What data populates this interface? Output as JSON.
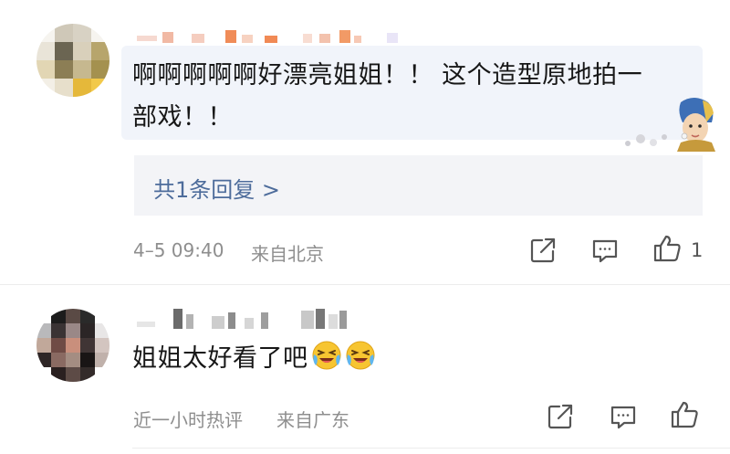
{
  "comments": [
    {
      "text_line1": "啊啊啊啊啊好漂亮姐姐！！ 这个造型原地拍一",
      "text_line2": "部戏！！",
      "replies_link": "共1条回复 >",
      "timestamp": "4–5 09:40",
      "location": "来自北京",
      "like_count": "1"
    },
    {
      "text": "姐姐太好看了吧",
      "emojis": [
        "laugh-cry-emoji",
        "laugh-cry-emoji"
      ],
      "timestamp": "近一小时热评",
      "location": "来自广东"
    }
  ],
  "icons": {
    "share": "share-icon",
    "comment": "comment-icon",
    "like": "thumbs-up-icon"
  },
  "colors": {
    "bubble_bg": "#f1f4fa",
    "link": "#4d6c9b",
    "meta": "#8e8e8e"
  }
}
